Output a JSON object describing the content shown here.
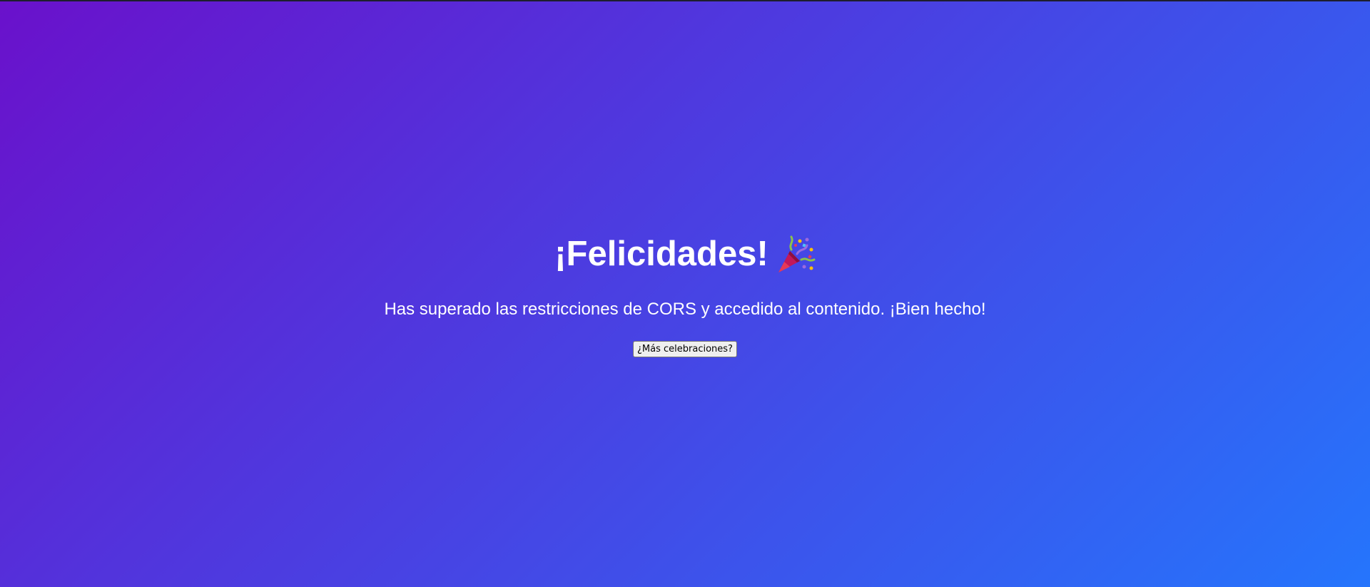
{
  "main": {
    "title": "¡Felicidades!",
    "title_icon": "party-popper-icon",
    "message": "Has superado las restricciones de CORS y accedido al contenido. ¡Bien hecho!",
    "button_label": "¿Más celebraciones?"
  },
  "colors": {
    "gradient_start": "#6a11cb",
    "gradient_end": "#2575fc",
    "text": "#ffffff"
  }
}
